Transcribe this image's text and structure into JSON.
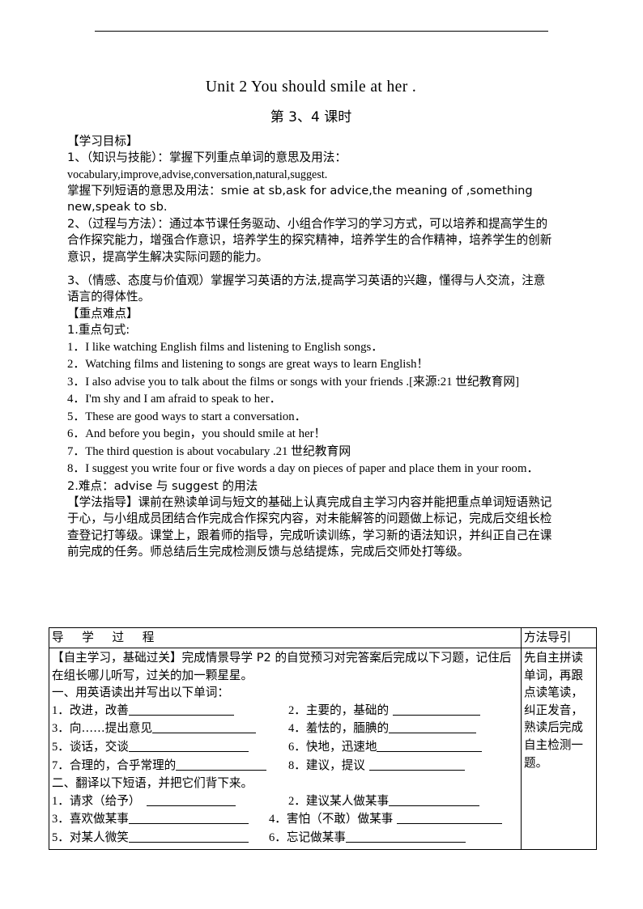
{
  "document": {
    "title": "Unit 2 You should smile at her .",
    "subtitle": "第 3、4 课时"
  },
  "objectives": {
    "heading": "【学习目标】",
    "item1": "1、（知识与技能）：掌握下列重点单词的意思及用法：",
    "item1_words": "vocabulary,improve,advise,conversation,natural,suggest.",
    "item1_phrases": "掌握下列短语的意思及用法：smie at sb,ask for advice,the meaning of ,something new,speak to sb.",
    "item2": "2、（过程与方法）：通过本节课任务驱动、小组合作学习的学习方式，可以培养和提高学生的合作探究能力，增强合作意识，培养学生的探究精神，培养学生的合作精神，培养学生的创新意识，提高学生解决实际问题的能力。",
    "item3": "3、（情感、态度与价值观）掌握学习英语的方法,提高学习英语的兴趣，懂得与人交流，注意语言的得体性。"
  },
  "key_points": {
    "heading": "【重点难点】",
    "subheading1": "1.重点句式:",
    "sentences": [
      "1．I like watching English films and listening to English songs．",
      "2．Watching films and listening to songs are great ways to learn English！",
      "3．I also advise you to talk about the films or songs with your friends .[来源:21 世纪教育网]",
      "4．I'm shy and I am afraid to speak to her．",
      "5．These are good ways to start a conversation．",
      "6．And before you begin，you should smile at her！",
      "7．The third question is about vocabulary .21 世纪教育网",
      "8．I suggest you write four or five words a day on pieces of paper and place them in your room．"
    ],
    "subheading2": "2.难点：advise 与 suggest 的用法"
  },
  "method_guidance": {
    "text": "【学法指导】课前在熟读单词与短文的基础上认真完成自主学习内容并能把重点单词短语熟记于心，与小组成员团结合作完成合作探究内容，对未能解答的问题做上标记，完成后交组长检查登记打等级。课堂上，跟着师的指导，完成听读训练，学习新的语法知识，并纠正自己在课前完成的任务。师总结后生完成检测反馈与总结提炼，完成后交师处打等级。"
  },
  "table": {
    "header_main": "导 学 过 程",
    "header_side": "方法导引",
    "side_text": "先自主拼读单词，再跟点读笔读，纠正发音，熟读后完成自主检测一题。",
    "intro": "【自主学习，基础过关】完成情景导学 P2 的自觉预习对完答案后完成以下习题，记住后在组长哪儿听写，过关的加一颗星星。",
    "section1_heading": "一、用英语读出并写出以下单词：",
    "words": [
      {
        "num": "1．",
        "text": "改进，改善",
        "blank": 130
      },
      {
        "num": "2．",
        "text": "主要的，基础的 ",
        "blank": 108
      },
      {
        "num": "3．",
        "text": "向……提出意见",
        "blank": 128
      },
      {
        "num": "4．",
        "text": "羞怯的，腼腆的",
        "blank": 108
      },
      {
        "num": "5．",
        "text": "谈话，交谈",
        "blank": 148
      },
      {
        "num": "6．",
        "text": "快地，迅速地",
        "blank": 130
      },
      {
        "num": "7．",
        "text": "合理的，合乎常理的",
        "blank": 112
      },
      {
        "num": "8．",
        "text": "建议，提议 ",
        "blank": 118
      }
    ],
    "section2_heading": "二、翻译以下短语，并把它们背下来。",
    "phrases": [
      {
        "num": "1．",
        "text": "请求（给予）　",
        "blank": 110
      },
      {
        "num": "2．",
        "text": "建议某人做某事",
        "blank": 112
      },
      {
        "num": "3．",
        "text": "喜欢做某事",
        "blank": 148
      },
      {
        "num": "4．",
        "text": "害怕（不敢）做某事 ",
        "blank": 130
      },
      {
        "num": "5．",
        "text": "对某人微笑",
        "blank": 148
      },
      {
        "num": "6．",
        "text": "忘记做某事",
        "blank": 148
      }
    ]
  },
  "colors": {
    "text": "#000000",
    "rule": "#000000",
    "background": "#ffffff"
  }
}
